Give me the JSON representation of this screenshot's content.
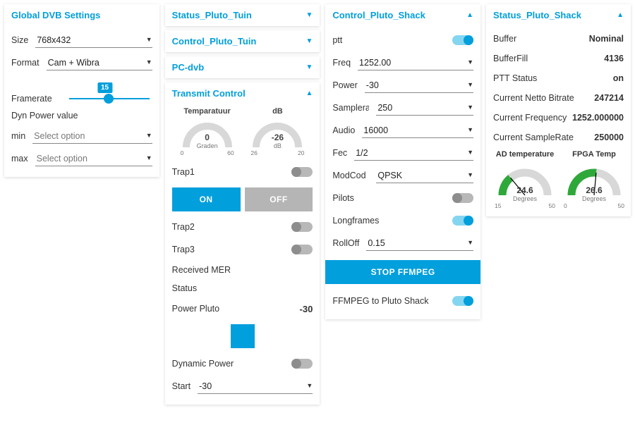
{
  "global": {
    "title": "Global DVB Settings",
    "size_label": "Size",
    "size_value": "768x432",
    "format_label": "Format",
    "format_value": "Cam + Wibra",
    "framerate_label": "Framerate",
    "framerate_value": "15",
    "dyn_label": "Dyn Power value",
    "min_label": "min",
    "min_value": "Select option",
    "max_label": "max",
    "max_value": "Select option"
  },
  "collapsed": {
    "status_tuin": "Status_Pluto_Tuin",
    "control_tuin": "Control_Pluto_Tuin",
    "pcdvb": "PC-dvb"
  },
  "transmit": {
    "title": "Transmit Control",
    "temp_label": "Temparatuur",
    "db_label": "dB",
    "temp_value": "0",
    "temp_unit": "Graden",
    "temp_min": "0",
    "temp_max": "60",
    "db_value": "-26",
    "db_unit": "dB",
    "db_min": "26",
    "db_max": "20",
    "trap1": "Trap1",
    "on": "ON",
    "off": "OFF",
    "trap2": "Trap2",
    "trap3": "Trap3",
    "recv_mer": "Received MER",
    "status": "Status",
    "power_pluto": "Power Pluto",
    "power_pluto_val": "-30",
    "dyn_power": "Dynamic Power",
    "start": "Start",
    "start_val": "-30"
  },
  "control_shack": {
    "title": "Control_Pluto_Shack",
    "ptt": "ptt",
    "ptt_on": true,
    "freq": "Freq",
    "freq_val": "1252.00",
    "power": "Power",
    "power_val": "-30",
    "samplerate": "Samplerate",
    "samplerate_val": "250",
    "audio": "Audio",
    "audio_val": "16000",
    "fec": "Fec",
    "fec_val": "1/2",
    "modcod": "ModCod",
    "modcod_val": "QPSK",
    "pilots": "Pilots",
    "pilots_on": false,
    "longframes": "Longframes",
    "longframes_on": true,
    "rolloff": "RollOff",
    "rolloff_val": "0.15",
    "stop_ffmpeg": "STOP FFMPEG",
    "ffmpeg_to": "FFMPEG to Pluto Shack",
    "ffmpeg_on": true
  },
  "status_shack": {
    "title": "Status_Pluto_Shack",
    "rows": [
      {
        "k": "Buffer",
        "v": "Nominal"
      },
      {
        "k": "BufferFill",
        "v": "4136"
      },
      {
        "k": "PTT Status",
        "v": "on"
      },
      {
        "k": "Current Netto Bitrate",
        "v": "247214"
      },
      {
        "k": "Current Frequency",
        "v": "1252.000000"
      },
      {
        "k": "Current SampleRate",
        "v": "250000"
      }
    ],
    "gauges": [
      {
        "title": "AD temperature",
        "val": "24.6",
        "unit": "Degrees",
        "min": "15",
        "max": "50"
      },
      {
        "title": "FPGA Temp",
        "val": "26.6",
        "unit": "Degrees",
        "min": "0",
        "max": "50"
      }
    ]
  }
}
